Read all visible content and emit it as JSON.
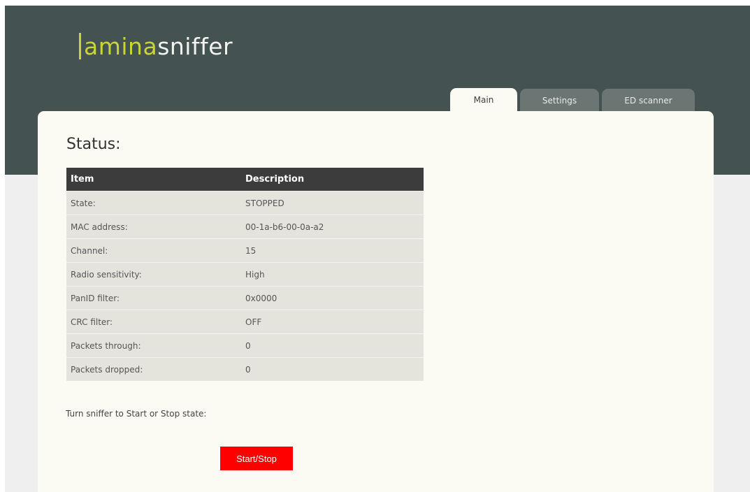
{
  "app": {
    "logo_part1": "amina",
    "logo_part2": "sniffer",
    "accent_color": "#c9d33a"
  },
  "tabs": [
    {
      "label": "Main",
      "active": true
    },
    {
      "label": "Settings",
      "active": false
    },
    {
      "label": "ED scanner",
      "active": false
    }
  ],
  "status": {
    "title": "Status:",
    "columns": [
      "Item",
      "Description"
    ],
    "rows": [
      [
        "State:",
        "STOPPED"
      ],
      [
        "MAC address:",
        "00-1a-b6-00-0a-a2"
      ],
      [
        "Channel:",
        "15"
      ],
      [
        "Radio sensitivity:",
        "High"
      ],
      [
        "PanID filter:",
        "0x0000"
      ],
      [
        "CRC filter:",
        "OFF"
      ],
      [
        "Packets through:",
        "0"
      ],
      [
        "Packets dropped:",
        "0"
      ]
    ]
  },
  "controls": {
    "hint": "Turn sniffer to Start or Stop state:",
    "start_stop_label": "Start/Stop",
    "button_color": "#ff0000"
  }
}
